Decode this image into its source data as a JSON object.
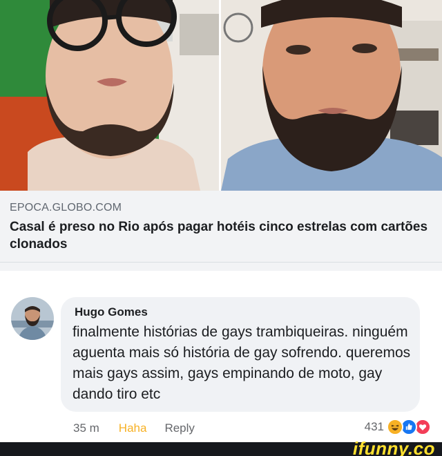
{
  "link_preview": {
    "domain": "EPOCA.GLOBO.COM",
    "headline": "Casal é preso no Rio após pagar hotéis cinco estrelas com cartões clonados"
  },
  "comment": {
    "author": "Hugo Gomes",
    "text": "finalmente histórias de gays trambiqueiras. ninguém aguenta mais só história de gay sofrendo. queremos mais gays assim, gays empinando de moto, gay dando tiro etc",
    "time": "35 m",
    "reaction_label": "Haha",
    "reply_label": "Reply",
    "reaction_count": "431",
    "reaction_icons": [
      "haha-icon",
      "like-icon",
      "love-icon"
    ]
  },
  "watermark": "ifunny.co",
  "colors": {
    "haha": "#f7b125",
    "like": "#1877f2",
    "love": "#f33e58",
    "watermark": "#ffe02e"
  }
}
